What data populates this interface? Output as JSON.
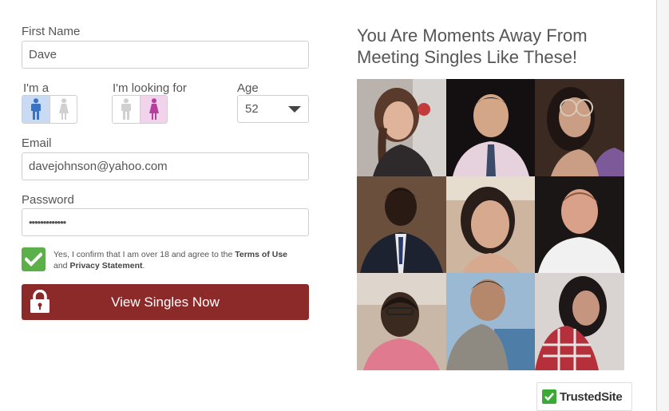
{
  "form": {
    "first_name_label": "First Name",
    "first_name_value": "Dave",
    "im_a_label": "I'm a",
    "looking_for_label": "I'm looking for",
    "age_label": "Age",
    "age_value": "52",
    "email_label": "Email",
    "email_value": "davejohnson@yahoo.com",
    "password_label": "Password",
    "password_value": "•••••••••••••",
    "terms_prefix": "Yes, I confirm that I am over 18 and agree to the ",
    "terms_link": "Terms of Use",
    "terms_and": " and ",
    "privacy_link": "Privacy Statement",
    "terms_suffix": ".",
    "submit_label": "View Singles Now",
    "gender_self": "male",
    "gender_seeking": "female"
  },
  "gallery": {
    "heading": "You Are Moments Away From Meeting Singles Like These!",
    "photo_count": 9
  },
  "badge": {
    "brand_a": "Trusted",
    "brand_b": "Site"
  },
  "colors": {
    "cta": "#8c2a2a",
    "checkbox": "#5cb04a",
    "male_selected": "#c9dbf3",
    "female_selected": "#f2d3ec",
    "male_icon": "#3a73c4",
    "female_icon": "#b53f9d"
  }
}
